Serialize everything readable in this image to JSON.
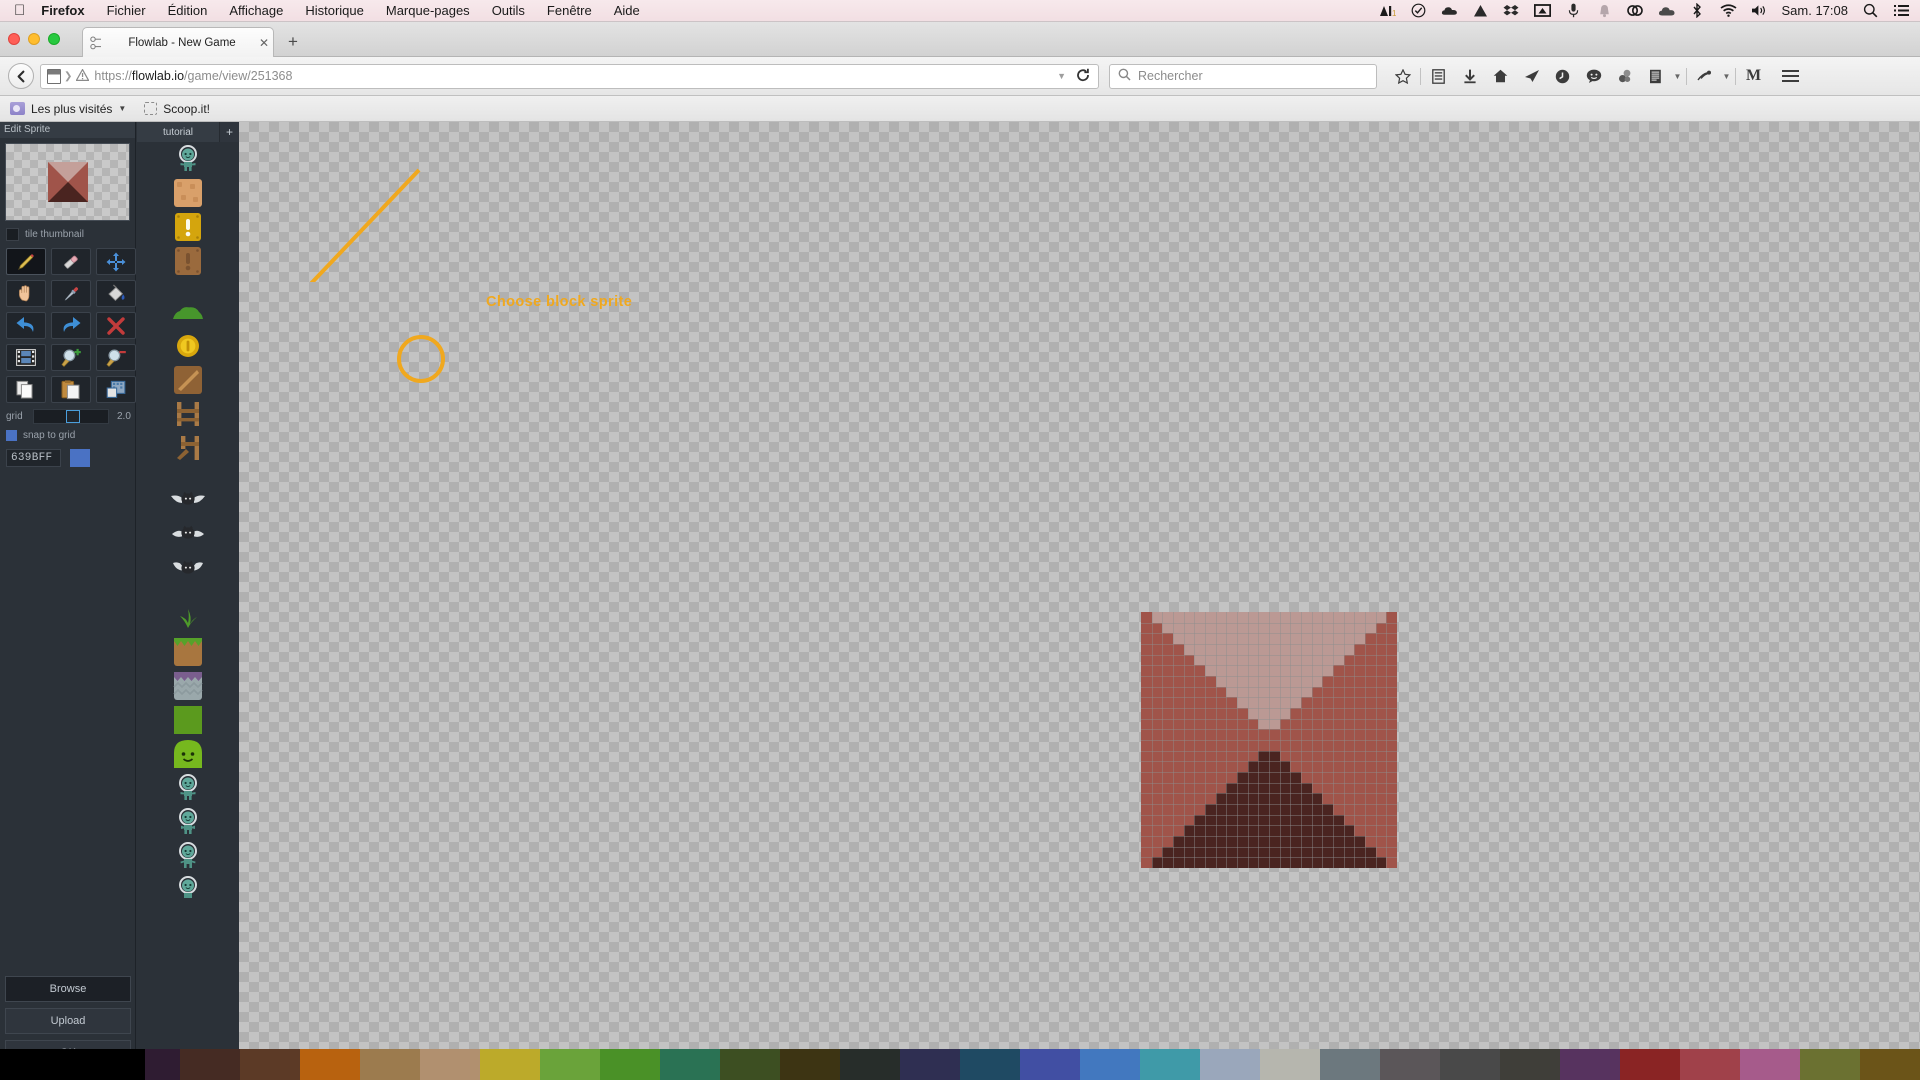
{
  "os_menubar": {
    "apple_icon": "apple-icon",
    "items": [
      {
        "label": "Firefox",
        "bold": true
      },
      {
        "label": "Fichier",
        "bold": false
      },
      {
        "label": "Édition",
        "bold": false
      },
      {
        "label": "Affichage",
        "bold": false
      },
      {
        "label": "Historique",
        "bold": false
      },
      {
        "label": "Marque-pages",
        "bold": false
      },
      {
        "label": "Outils",
        "bold": false
      },
      {
        "label": "Fenêtre",
        "bold": false
      },
      {
        "label": "Aide",
        "bold": false
      }
    ],
    "status_icons": [
      "adobe-ai-icon",
      "checkmark-circle-icon",
      "cloud-icon",
      "google-drive-icon",
      "dropbox-icon",
      "airplay-icon",
      "microphone-icon",
      "bell-icon",
      "creative-cloud-icon",
      "onedrive-icon",
      "bluetooth-icon",
      "wifi-icon",
      "volume-icon"
    ],
    "clock": "Sam. 17:08",
    "spotlight_icon": "search-icon",
    "notification_icon": "list-icon"
  },
  "browser": {
    "window_controls": [
      "close-button",
      "minimize-button",
      "zoom-button"
    ],
    "tab": {
      "favicon": "flowlab-node-icon",
      "title": "Flowlab - New Game",
      "close_label": "✕"
    },
    "new_tab_label": "+",
    "back_label": "⮜",
    "url": {
      "protocol": "https://",
      "domain": "flowlab.io",
      "path": "/game/view/251368",
      "warning_icon": "insecure-warning-icon",
      "site_identity_icon": "page-icon",
      "dropdown_icon": "chevron-down-icon",
      "reload_icon": "reload-icon"
    },
    "search": {
      "placeholder": "Rechercher",
      "icon": "search-icon"
    },
    "toolbar_icons": [
      "bookmark-star-icon",
      "reader-list-icon",
      "download-arrow-icon",
      "home-icon",
      "send-tab-icon",
      "history-clock-icon",
      "chat-bubble-icon",
      "pocket-icon",
      "reader-mode-icon",
      "chevron-down-icon",
      "extension-icon",
      "chevron-down-icon",
      "medium-m-icon"
    ],
    "menu_icon": "hamburger-menu-icon",
    "bookmarks": [
      {
        "label": "Les plus visités",
        "icon": "folder-icon",
        "has_caret": true
      },
      {
        "label": "Scoop.it!",
        "icon": "dashed-square-icon",
        "has_caret": false
      }
    ]
  },
  "editor": {
    "title": "Edit Sprite",
    "thumbnail_label": "tile thumbnail",
    "tools": [
      {
        "name": "pencil-tool",
        "icon": "pencil-icon",
        "selected": true
      },
      {
        "name": "eraser-tool",
        "icon": "eraser-icon",
        "selected": false
      },
      {
        "name": "move-tool",
        "icon": "move-arrows-icon",
        "selected": false
      },
      {
        "name": "pan-tool",
        "icon": "hand-icon",
        "selected": false
      },
      {
        "name": "eyedropper-tool",
        "icon": "eyedropper-icon",
        "selected": false
      },
      {
        "name": "fill-tool",
        "icon": "paint-bucket-icon",
        "selected": false
      },
      {
        "name": "undo-tool",
        "icon": "undo-arrow-icon",
        "selected": false
      },
      {
        "name": "redo-tool",
        "icon": "redo-arrow-icon",
        "selected": false
      },
      {
        "name": "clear-tool",
        "icon": "red-x-icon",
        "selected": false
      },
      {
        "name": "animation-tool",
        "icon": "film-strip-icon",
        "selected": false
      },
      {
        "name": "zoom-in-tool",
        "icon": "magnifier-plus-icon",
        "selected": false
      },
      {
        "name": "zoom-out-tool",
        "icon": "magnifier-minus-icon",
        "selected": false
      },
      {
        "name": "copy-tool",
        "icon": "copy-pages-icon",
        "selected": false
      },
      {
        "name": "paste-tool",
        "icon": "paste-clipboard-icon",
        "selected": false
      },
      {
        "name": "import-tool",
        "icon": "import-image-icon",
        "selected": false
      }
    ],
    "grid_label": "grid",
    "grid_value": "2.0",
    "snap_label": "snap to grid",
    "snap_checked": true,
    "hex_value": "639BFF",
    "current_color": "#4a72c4",
    "buttons": [
      {
        "label": "Browse",
        "name": "browse-button"
      },
      {
        "label": "Upload",
        "name": "upload-button"
      },
      {
        "label": "OK",
        "name": "ok-button"
      }
    ]
  },
  "picker": {
    "tab_label": "tutorial",
    "add_label": "+",
    "sprites": [
      {
        "name": "astronaut-sprite",
        "icon": "astronaut-icon",
        "gap_after": false
      },
      {
        "name": "crate-block-sprite",
        "icon": "brown-crate-icon",
        "gap_after": false,
        "highlighted": true
      },
      {
        "name": "yellow-block-sprite",
        "icon": "yellow-exclamation-block-icon",
        "gap_after": false
      },
      {
        "name": "brown-block-sprite",
        "icon": "brown-exclamation-block-icon",
        "gap_after": true
      },
      {
        "name": "bush-sprite",
        "icon": "green-bush-icon",
        "gap_after": false
      },
      {
        "name": "coin-sprite",
        "icon": "gold-coin-icon",
        "gap_after": false
      },
      {
        "name": "ramp-sprite",
        "icon": "wooden-ramp-icon",
        "gap_after": false
      },
      {
        "name": "ladder-sprite",
        "icon": "wooden-ladder-icon",
        "gap_after": false
      },
      {
        "name": "ladder-broken-sprite",
        "icon": "broken-ladder-icon",
        "gap_after": true
      },
      {
        "name": "bat-sprite-1",
        "icon": "bat-flying-icon",
        "gap_after": false
      },
      {
        "name": "bat-sprite-2",
        "icon": "bat-flying-icon",
        "gap_after": false
      },
      {
        "name": "bat-sprite-3",
        "icon": "bat-flying-icon",
        "gap_after": true
      },
      {
        "name": "grass-tuft-sprite",
        "icon": "grass-tuft-icon",
        "gap_after": false
      },
      {
        "name": "dirt-ground-sprite",
        "icon": "grass-dirt-tile-icon",
        "gap_after": false
      },
      {
        "name": "stone-ground-sprite",
        "icon": "stone-tile-icon",
        "gap_after": false
      },
      {
        "name": "green-block-sprite",
        "icon": "green-square-icon",
        "gap_after": false
      },
      {
        "name": "slime-sprite",
        "icon": "green-slime-icon",
        "gap_after": false
      },
      {
        "name": "player-sprite-1",
        "icon": "astronaut-icon",
        "gap_after": false
      },
      {
        "name": "player-sprite-2",
        "icon": "astronaut-icon",
        "gap_after": false
      },
      {
        "name": "player-sprite-3",
        "icon": "astronaut-icon",
        "gap_after": false
      },
      {
        "name": "player-sprite-4",
        "icon": "astronaut-icon",
        "gap_after": false
      }
    ]
  },
  "annotation": {
    "text": "Choose block sprite",
    "color": "#f0a81e"
  },
  "sprite": {
    "grid_size": 24,
    "colors": {
      "side": "#a0544a",
      "top": "#bb9994",
      "bottom": "#4a2420",
      "gridline": "#8d8d8d"
    }
  },
  "palette_colors": [
    "#000000",
    "#18182b",
    "#2f1c32",
    "#452b23",
    "#5c3a26",
    "#b8620f",
    "#9c7b4e",
    "#b1906f",
    "#bcaa2a",
    "#6aa33a",
    "#4a9127",
    "#2a7254",
    "#3d4f22",
    "#3d3413",
    "#272d2a",
    "#2f2f52",
    "#1f4a63",
    "#414fa3",
    "#4278bf",
    "#3f9aa8",
    "#9aa7bb",
    "#b6b6ae",
    "#6c787e",
    "#5b5659",
    "#494949",
    "#3f3e39",
    "#57335f",
    "#8a2424",
    "#a0414a",
    "#a65b8b",
    "#6b7131",
    "#6b5418"
  ]
}
